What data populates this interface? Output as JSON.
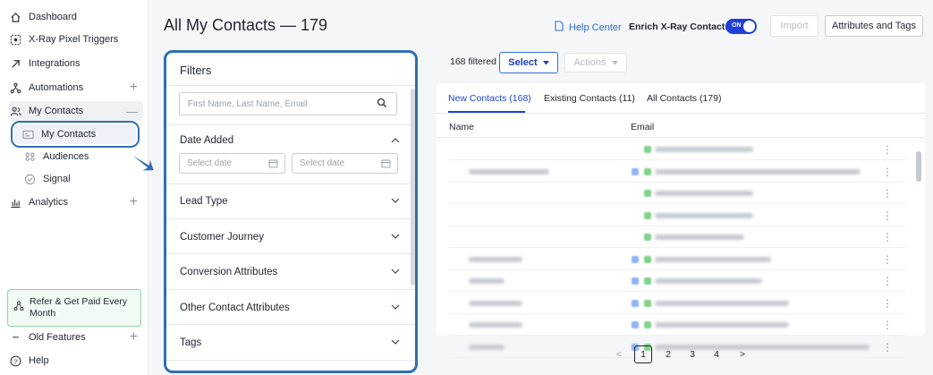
{
  "sidebar": {
    "items": [
      {
        "label": "Dashboard",
        "icon": "home-icon"
      },
      {
        "label": "X-Ray Pixel Triggers",
        "icon": "pixel-icon"
      },
      {
        "label": "Integrations",
        "icon": "integrations-icon"
      },
      {
        "label": "Automations",
        "icon": "automations-icon",
        "plus": "+"
      },
      {
        "label": "My Contacts",
        "icon": "contacts-icon",
        "minus": "—"
      }
    ],
    "sub_items": [
      {
        "label": "My Contacts",
        "icon": "contact-card-icon"
      },
      {
        "label": "Audiences",
        "icon": "audiences-icon"
      },
      {
        "label": "Signal",
        "icon": "signal-icon"
      }
    ],
    "analytics": {
      "label": "Analytics",
      "plus": "+"
    },
    "refer": "Refer & Get Paid Every Month",
    "old_features": {
      "label": "Old Features",
      "plus": "+"
    },
    "help": "Help"
  },
  "header": {
    "title": "All My Contacts — 179",
    "help_center": "Help Center",
    "enrich_label": "Enrich X-Ray Contacts",
    "toggle_text": "ON",
    "import_label": "Import",
    "attributes_label": "Attributes and Tags"
  },
  "filters": {
    "title": "Filters",
    "search_placeholder": "First Name, Last Name, Email",
    "date_added": "Date Added",
    "date_placeholder_1": "Select date",
    "date_placeholder_2": "Select date",
    "sections": [
      "Lead Type",
      "Customer Journey",
      "Conversion Attributes",
      "Other Contact Attributes",
      "Tags"
    ]
  },
  "toolbar": {
    "filtered": "168 filtered",
    "select_label": "Select",
    "actions_label": "Actions"
  },
  "tabs": [
    "New Contacts (168)",
    "Existing Contacts (11)",
    "All Contacts (179)"
  ],
  "table": {
    "col_name": "Name",
    "col_email": "Email"
  },
  "pagination": {
    "prev": "<",
    "pages": [
      "1",
      "2",
      "3",
      "4"
    ],
    "next": ">",
    "current": "1"
  },
  "colors": {
    "accent": "#1e40d8",
    "highlight": "#2f6fb0",
    "refer_border": "#8fd3a0"
  }
}
